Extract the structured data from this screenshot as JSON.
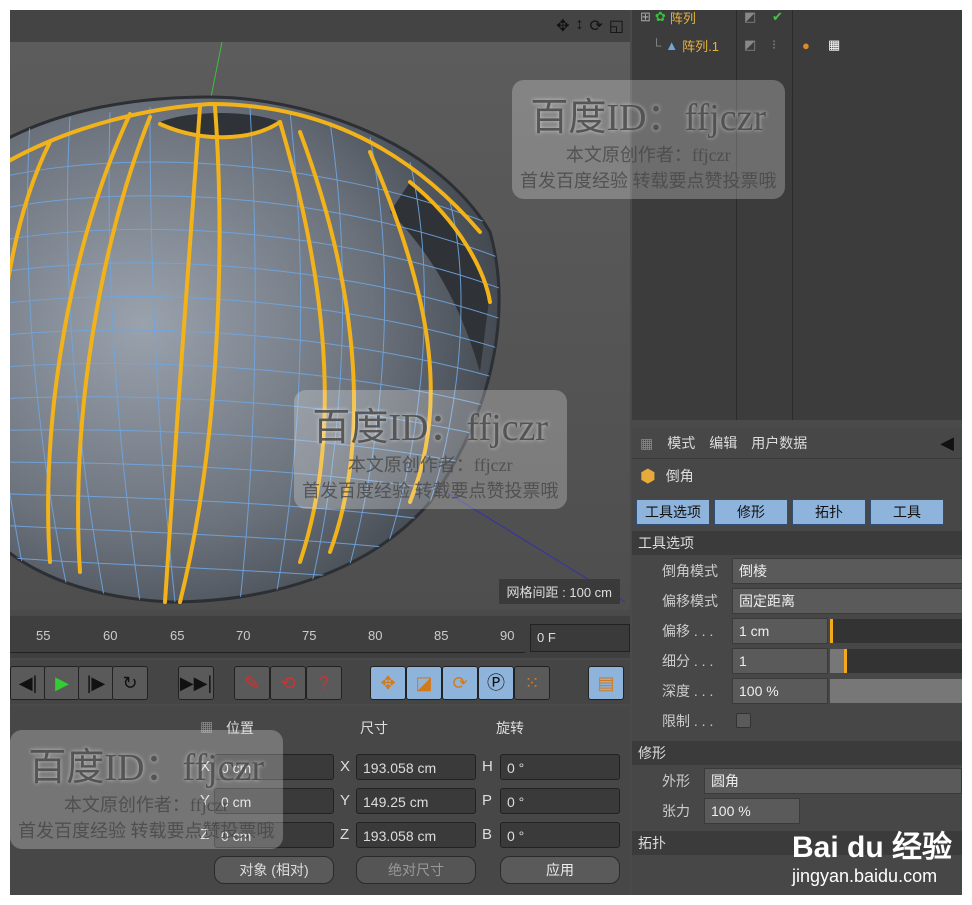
{
  "viewport": {
    "grid_spacing": "网格间距 : 100 cm"
  },
  "object_manager": {
    "rows": [
      {
        "name": "阵列"
      },
      {
        "name": "阵列.1"
      }
    ]
  },
  "attributes": {
    "menu": [
      "模式",
      "编辑",
      "用户数据"
    ],
    "tool_name": "倒角",
    "tabs": [
      "工具选项",
      "修形",
      "拓扑",
      "工具"
    ],
    "section_tool": "工具选项",
    "params": [
      {
        "label": "倒角模式",
        "value": "倒棱"
      },
      {
        "label": "偏移模式",
        "value": "固定距离"
      },
      {
        "label": "偏移 . . .",
        "value": "1 cm"
      },
      {
        "label": "细分 . . .",
        "value": "1"
      },
      {
        "label": "深度 . . .",
        "value": "100 %"
      },
      {
        "label": "限制 . . ."
      }
    ],
    "section_shape": "修形",
    "shape_params": [
      {
        "label": "外形",
        "value": "圆角"
      },
      {
        "label": "张力",
        "value": "100 %"
      }
    ],
    "section_topo": "拓扑"
  },
  "timeline": {
    "ticks": [
      "55",
      "60",
      "65",
      "70",
      "75",
      "80",
      "85",
      "90"
    ],
    "current_frame": "0 F"
  },
  "coords": {
    "headers": [
      "位置",
      "尺寸",
      "旋转"
    ],
    "position": [
      {
        "axis": "X",
        "value": "0 cm"
      },
      {
        "axis": "Y",
        "value": "0 cm"
      },
      {
        "axis": "Z",
        "value": "0 cm"
      }
    ],
    "size": [
      {
        "axis": "X",
        "value": "193.058 cm"
      },
      {
        "axis": "Y",
        "value": "149.25 cm"
      },
      {
        "axis": "Z",
        "value": "193.058 cm"
      }
    ],
    "rotation": [
      {
        "axis": "H",
        "value": "0 °"
      },
      {
        "axis": "P",
        "value": "0 °"
      },
      {
        "axis": "B",
        "value": "0 °"
      }
    ],
    "mode_select": "对象 (相对)",
    "size_select": "绝对尺寸",
    "apply": "应用"
  },
  "watermark": {
    "line1": "百度ID：",
    "id": "ffjczr",
    "line2": "本文原创作者：ffjczr",
    "line3": "首发百度经验 转载要点赞投票哦"
  },
  "baidu": {
    "logo": "Bai du 经验",
    "url": "jingyan.baidu.com"
  },
  "colors": {
    "accent_orange": "#f2b21a",
    "wire_blue": "#6fa6e0",
    "tab_blue": "#8fb4dc"
  }
}
